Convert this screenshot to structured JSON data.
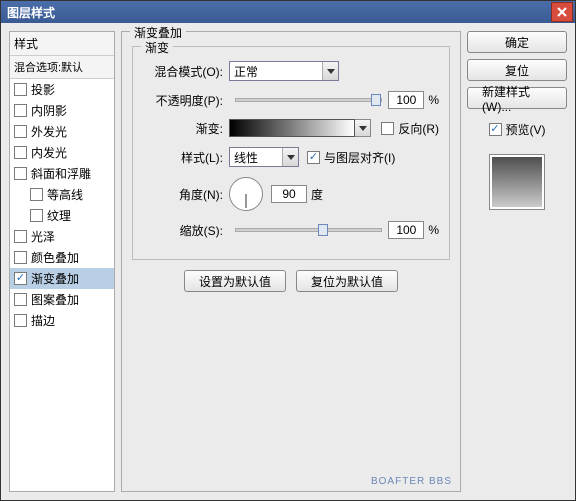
{
  "window": {
    "title": "图层样式"
  },
  "left": {
    "header": "样式",
    "subheader": "混合选项:默认",
    "items": [
      {
        "label": "投影",
        "checked": false
      },
      {
        "label": "内阴影",
        "checked": false
      },
      {
        "label": "外发光",
        "checked": false
      },
      {
        "label": "内发光",
        "checked": false
      },
      {
        "label": "斜面和浮雕",
        "checked": false
      },
      {
        "label": "等高线",
        "checked": false,
        "nested": true
      },
      {
        "label": "纹理",
        "checked": false,
        "nested": true
      },
      {
        "label": "光泽",
        "checked": false
      },
      {
        "label": "颜色叠加",
        "checked": false
      },
      {
        "label": "渐变叠加",
        "checked": true,
        "selected": true
      },
      {
        "label": "图案叠加",
        "checked": false
      },
      {
        "label": "描边",
        "checked": false
      }
    ]
  },
  "center": {
    "group_title": "渐变叠加",
    "inner_title": "渐变",
    "blend_label": "混合模式(O):",
    "blend_value": "正常",
    "opacity_label": "不透明度(P):",
    "opacity_value": "100",
    "opacity_unit": "%",
    "gradient_label": "渐变:",
    "reverse_label": "反向(R)",
    "style_label": "样式(L):",
    "style_value": "线性",
    "align_label": "与图层对齐(I)",
    "angle_label": "角度(N):",
    "angle_value": "90",
    "angle_unit": "度",
    "scale_label": "缩放(S):",
    "scale_value": "100",
    "scale_unit": "%",
    "set_default": "设置为默认值",
    "reset_default": "复位为默认值"
  },
  "right": {
    "ok": "确定",
    "cancel": "复位",
    "new_style": "新建样式(W)...",
    "preview": "预览(V)"
  },
  "watermark": "BOAFTER BBS"
}
